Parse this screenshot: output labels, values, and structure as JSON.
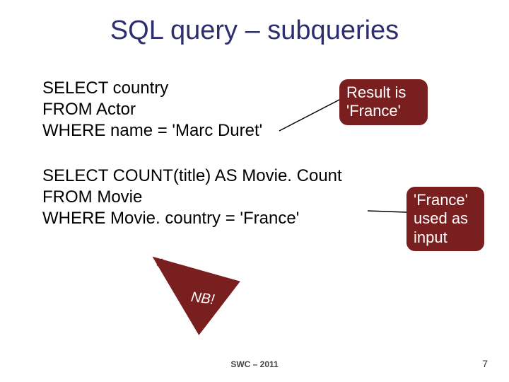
{
  "title": "SQL query – subqueries",
  "query1": {
    "line1": "SELECT country",
    "line2": "FROM Actor",
    "line3": "WHERE name = 'Marc Duret'"
  },
  "query2": {
    "line1": "SELECT COUNT(title) AS Movie. Count",
    "line2": "FROM Movie",
    "line3": "WHERE Movie. country = 'France'"
  },
  "callout1": {
    "line1": "Result is",
    "line2": "'France'"
  },
  "callout2": {
    "line1": "'France'",
    "line2": "used as",
    "line3": "input"
  },
  "nb": "NB!",
  "footer": "SWC – 2011",
  "page": "7"
}
